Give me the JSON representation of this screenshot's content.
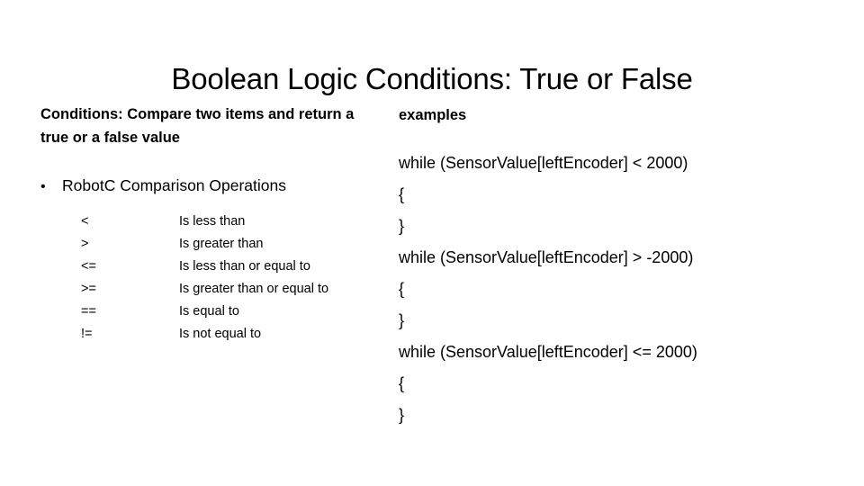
{
  "slide": {
    "title": "Boolean Logic Conditions: True or False"
  },
  "left": {
    "lead_paragraph": "Conditions: Compare two items and return a true or a false value",
    "bullet_mark": "•",
    "bullet_text": "RobotC Comparison Operations",
    "operators": [
      {
        "symbol": "<",
        "description": "Is less than"
      },
      {
        "symbol": ">",
        "description": "Is greater than"
      },
      {
        "symbol": "<=",
        "description": "Is less than or equal to"
      },
      {
        "symbol": ">=",
        "description": "Is greater than or equal to"
      },
      {
        "symbol": "==",
        "description": "Is equal to"
      },
      {
        "symbol": "!=",
        "description": "Is not equal to"
      }
    ]
  },
  "right": {
    "heading": "examples",
    "code_lines": [
      "while (SensorValue[leftEncoder] < 2000)",
      "{",
      "}",
      "while (SensorValue[leftEncoder] > -2000)",
      "{",
      "}",
      "while (SensorValue[leftEncoder] <= 2000)",
      "{",
      "}"
    ]
  },
  "colors": {
    "background": "#ffffff",
    "text": "#000000"
  }
}
